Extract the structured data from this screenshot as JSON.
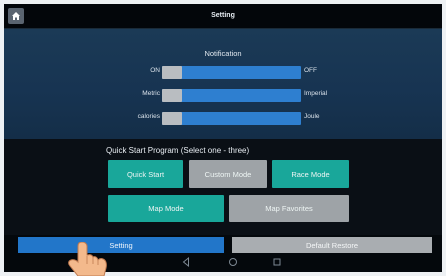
{
  "window": {
    "title": "Setting"
  },
  "icons": {
    "home": "home-icon",
    "back": "back-icon",
    "nav_home": "nav-home-icon",
    "recents": "recents-icon",
    "hand": "pointing-hand-icon"
  },
  "notification": {
    "heading": "Notification",
    "rows": [
      {
        "left": "ON",
        "right": "OFF"
      },
      {
        "left": "Metric",
        "right": "Imperial"
      },
      {
        "left": "calories",
        "right": "Joule"
      }
    ]
  },
  "quick_start": {
    "heading": "Quick Start Program (Select one - three)",
    "buttons": [
      "Quick Start",
      "Custom Mode",
      "Race Mode",
      "Map Mode",
      "Map Favorites"
    ]
  },
  "bottom": {
    "setting": "Setting",
    "restore": "Default Restore"
  },
  "colors": {
    "accent_blue": "#2276c9",
    "teal": "#19a79a",
    "gray": "#9ea3a7"
  }
}
